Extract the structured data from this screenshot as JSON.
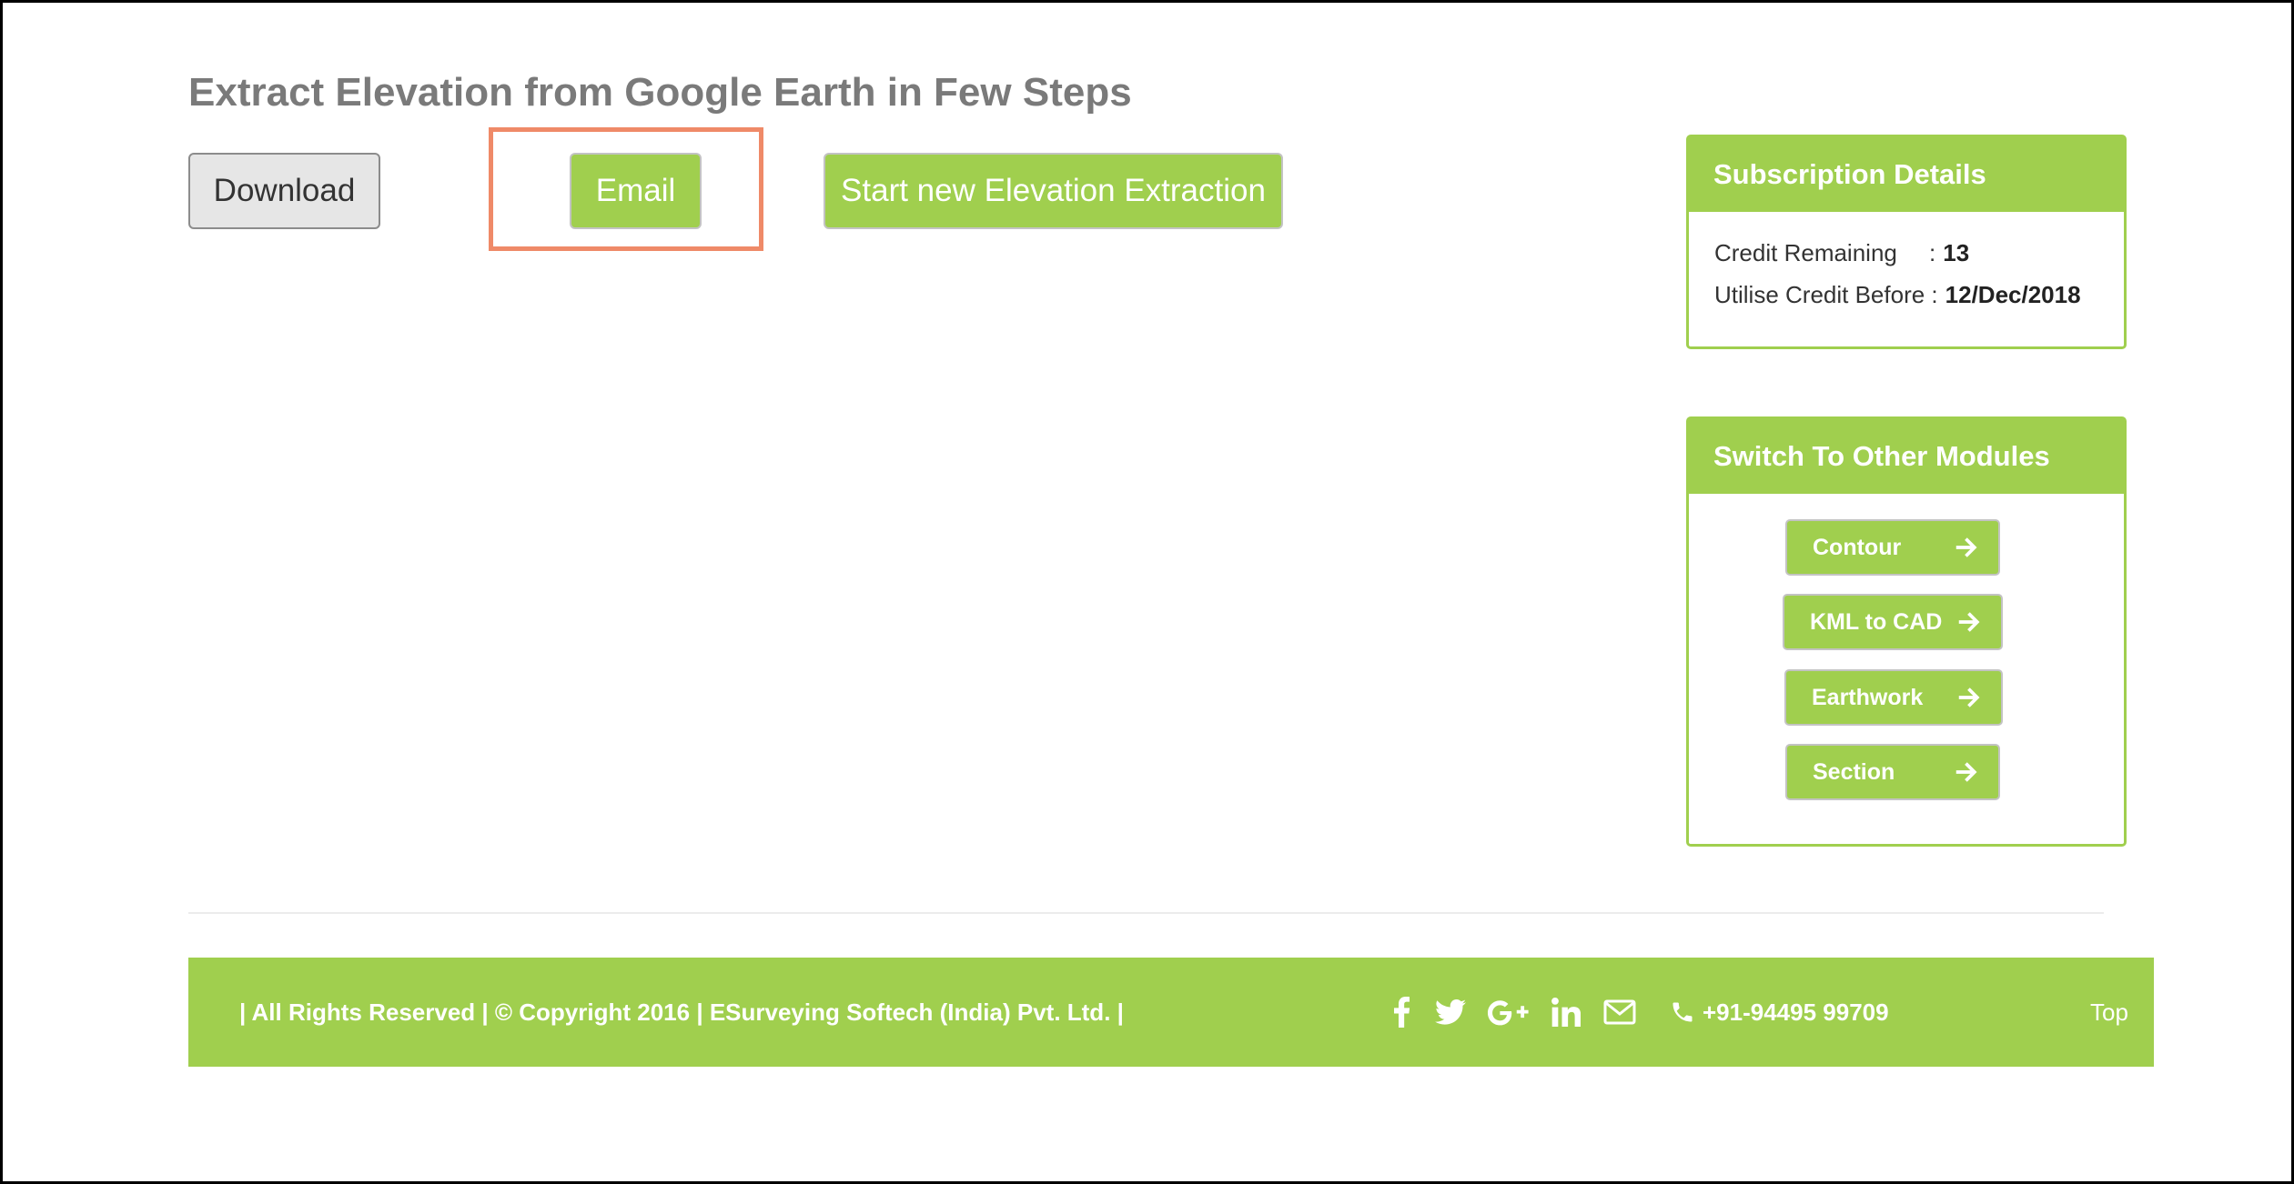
{
  "page": {
    "title": "Extract Elevation from Google Earth in Few Steps"
  },
  "actions": {
    "download_label": "Download",
    "email_label": "Email",
    "start_label": "Start new Elevation Extraction"
  },
  "subscription": {
    "heading": "Subscription Details",
    "credit_label": "Credit Remaining",
    "credit_sep": ":",
    "credit_value": "13",
    "utilise_label": "Utilise Credit Before :",
    "utilise_value": "12/Dec/2018"
  },
  "modules": {
    "heading": "Switch To Other Modules",
    "items": [
      {
        "label": "Contour"
      },
      {
        "label": "KML to CAD"
      },
      {
        "label": "Earthwork"
      },
      {
        "label": "Section"
      }
    ]
  },
  "footer": {
    "copyright": "| All Rights Reserved | © Copyright 2016 | ESurveying Softech (India) Pvt. Ltd. |",
    "social_icons": [
      "facebook-icon",
      "twitter-icon",
      "google-plus-icon",
      "linkedin-icon",
      "envelope-icon"
    ],
    "phone": "+91-94495 99709",
    "top_label": "Top"
  },
  "colors": {
    "accent": "#a0cf4e",
    "highlight": "#ef8a68",
    "title_gray": "#7a7a7a"
  }
}
